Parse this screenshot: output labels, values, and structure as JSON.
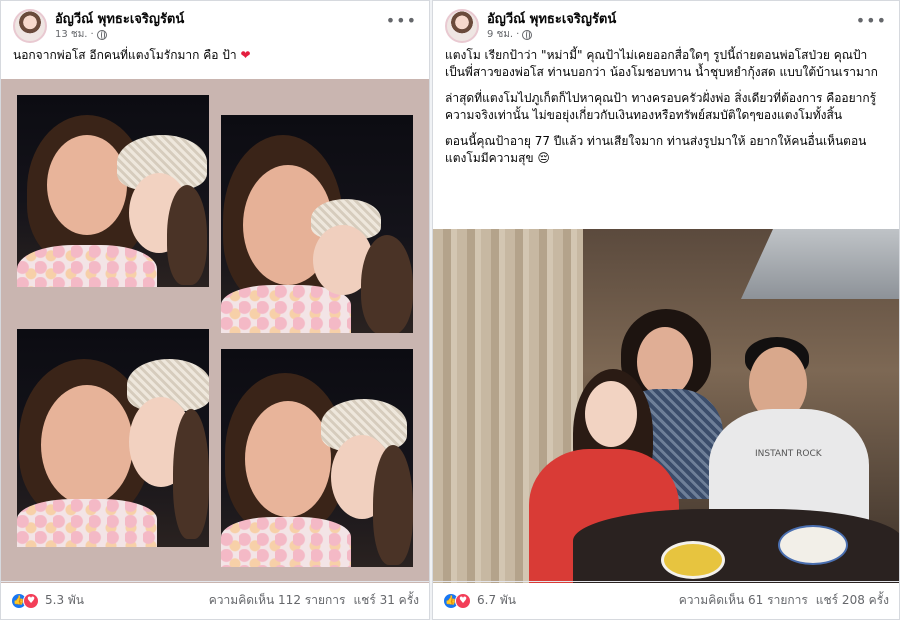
{
  "left_post": {
    "author": "อัญวีณ์ พุทธะเจริญรัตน์",
    "time": "13 ชม.",
    "text": "นอกจากพ่อโส อีกคนที่แตงโมรักมาก คือ ป้า",
    "reactions_count": "5.3 พัน",
    "comments": "ความคิดเห็น 112 รายการ",
    "shares": "แชร์ 31 ครั้ง"
  },
  "right_post": {
    "author": "อัญวีณ์ พุทธะเจริญรัตน์",
    "time": "9 ชม.",
    "paragraphs": [
      "แตงโม เรียกป้าว่า \"หม่ามี้\" คุณป้าไม่เคยออกสื่อใดๆ รูปนี้ถ่ายตอนพ่อโสป่วย คุณป้าเป็นพี่สาวของพ่อโส ท่านบอกว่า น้องโมชอบทาน น้ำชุบหยำกุ้งสด แบบใต้บ้านเรามาก",
      "ล่าสุดที่แตงโมไปภูเก็ตก็ไปหาคุณป้า ทางครอบครัวฝั่งพ่อ สิ่งเดียวที่ต้องการ คืออยากรู้ความจริงเท่านั้น ไม่ขอยุ่งเกี่ยวกับเงินทองหรือทรัพย์สมบัติใดๆของแตงโมทั้งสิ้น",
      "ตอนนี้คุณป้าอายุ 77 ปีแล้ว ท่านเสียใจมาก ท่านส่งรูปมาให้ อยากให้คนอื่นเห็นตอนแตงโมมีความสุข 😔"
    ],
    "photo_shirt_text": "INSTANT ROCK",
    "reactions_count": "6.7 พัน",
    "comments": "ความคิดเห็น 61 รายการ",
    "shares": "แชร์ 208 ครั้ง"
  }
}
